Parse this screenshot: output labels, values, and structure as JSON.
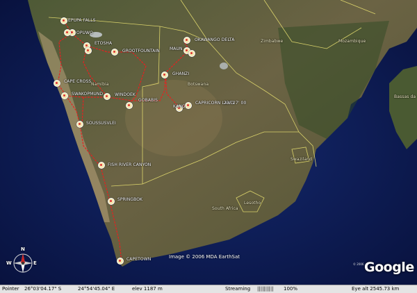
{
  "map": {
    "places": [
      {
        "name": "EPUPA FALLS"
      },
      {
        "name": "OPUWO"
      },
      {
        "name": "ETOSHA"
      },
      {
        "name": "GROOTFOUNTAIN"
      },
      {
        "name": "CAPE CROSS"
      },
      {
        "name": "SWAKOPMUND"
      },
      {
        "name": "WINDOEK"
      },
      {
        "name": "GOBABIS"
      },
      {
        "name": "SOUSSUSVLEI"
      },
      {
        "name": "FISH RIVER CANYON"
      },
      {
        "name": "SPRINGBOK"
      },
      {
        "name": "CAPETOWN"
      },
      {
        "name": "OKAWANGO DELTA"
      },
      {
        "name": "MAUN"
      },
      {
        "name": "GHANZI"
      },
      {
        "name": "KANG"
      },
      {
        "name": "CAPRICORN LAND"
      }
    ],
    "regions": [
      "Namibia",
      "Botswana",
      "Zimbabwe",
      "Mozambique",
      "South Africa",
      "Lesotho",
      "Swaziland",
      "Bassas da"
    ],
    "coordinate_label": "23° 27' 00",
    "imagery_credit": "Image © 2006 MDA EarthSat",
    "logo_text": "Google",
    "logo_copyright": "© 2006"
  },
  "compass": {
    "n": "N",
    "e": "E",
    "w": "W"
  },
  "status": {
    "pointer_label": "Pointer",
    "pointer_lat": "26°03'04.17\" S",
    "pointer_lon": "24°54'45.04\" E",
    "elev": "elev 1187 m",
    "streaming_label": "Streaming",
    "streaming_bar": "||||||||||",
    "streaming_pct": "100%",
    "eye_alt": "Eye alt 2545.73 km"
  },
  "colors": {
    "route": "#e82020",
    "border": "#e8e070",
    "ocean": "#0b1a52",
    "land": "#5c5a3a"
  }
}
